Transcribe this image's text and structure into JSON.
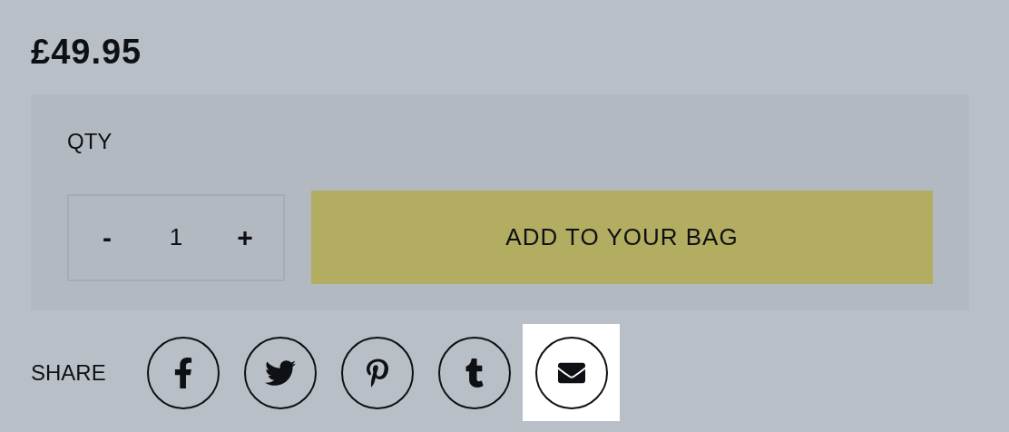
{
  "price": "£49.95",
  "purchase": {
    "qty_label": "QTY",
    "decrement": "-",
    "quantity": "1",
    "increment": "+",
    "add_button": "ADD TO YOUR BAG"
  },
  "share": {
    "label": "SHARE",
    "buttons": [
      {
        "kind": "facebook",
        "highlighted": false
      },
      {
        "kind": "twitter",
        "highlighted": false
      },
      {
        "kind": "pinterest",
        "highlighted": false
      },
      {
        "kind": "tumblr",
        "highlighted": false
      },
      {
        "kind": "email",
        "highlighted": true
      }
    ]
  }
}
